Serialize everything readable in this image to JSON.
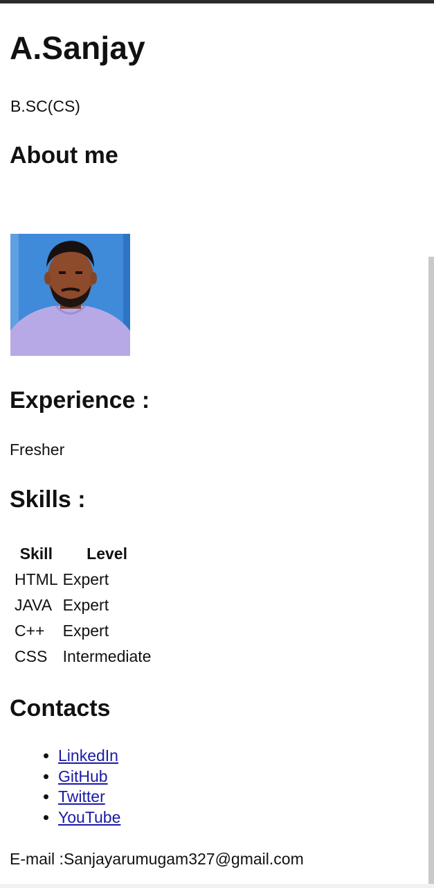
{
  "profile": {
    "name": "A.Sanjay",
    "degree": "B.SC(CS)"
  },
  "about": {
    "heading": "About me"
  },
  "experience": {
    "heading": "Experience :",
    "value": "Fresher"
  },
  "skills": {
    "heading": "Skills :",
    "columns": [
      "Skill",
      "Level"
    ],
    "rows": [
      {
        "skill": "HTML",
        "level": "Expert"
      },
      {
        "skill": "JAVA",
        "level": "Expert"
      },
      {
        "skill": "C++",
        "level": "Expert"
      },
      {
        "skill": "CSS",
        "level": "Intermediate"
      }
    ]
  },
  "contacts": {
    "heading": "Contacts",
    "links": [
      {
        "label": "LinkedIn"
      },
      {
        "label": "GitHub"
      },
      {
        "label": "Twitter"
      },
      {
        "label": "YouTube"
      }
    ],
    "email_text": "E-mail :Sanjayarumugam327@gmail.com"
  },
  "colors": {
    "link": "#1a1aa6",
    "photo_background": "#3d88d8",
    "text": "#111111"
  }
}
